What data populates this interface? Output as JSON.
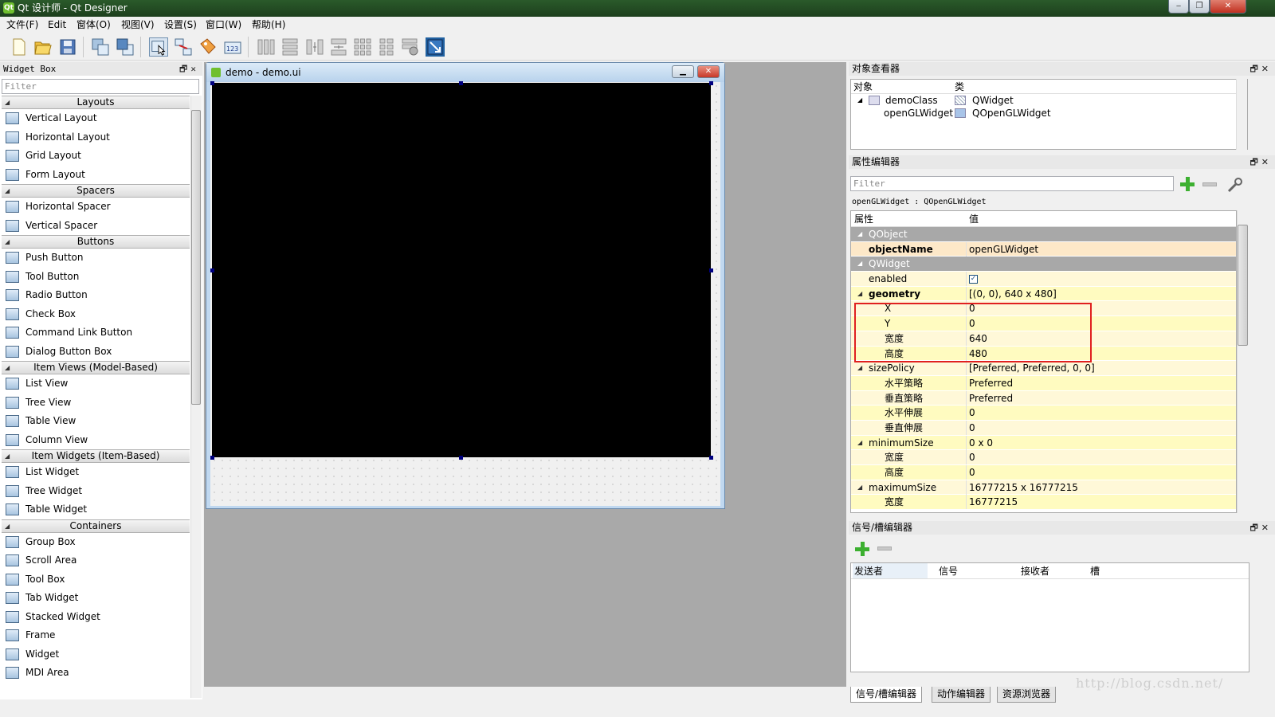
{
  "window": {
    "title": "Qt 设计师 - Qt Designer",
    "min": "‒",
    "max": "❐",
    "close": "✕"
  },
  "menu": [
    "文件(F)",
    "Edit",
    "窗体(O)",
    "视图(V)",
    "设置(S)",
    "窗口(W)",
    "帮助(H)"
  ],
  "widget_box": {
    "title": "Widget Box",
    "filter_placeholder": "Filter",
    "categories": [
      {
        "label": "Layouts",
        "items": [
          "Vertical Layout",
          "Horizontal Layout",
          "Grid Layout",
          "Form Layout"
        ]
      },
      {
        "label": "Spacers",
        "items": [
          "Horizontal Spacer",
          "Vertical Spacer"
        ]
      },
      {
        "label": "Buttons",
        "items": [
          "Push Button",
          "Tool Button",
          "Radio Button",
          "Check Box",
          "Command Link Button",
          "Dialog Button Box"
        ]
      },
      {
        "label": "Item Views (Model-Based)",
        "items": [
          "List View",
          "Tree View",
          "Table View",
          "Column View"
        ]
      },
      {
        "label": "Item Widgets (Item-Based)",
        "items": [
          "List Widget",
          "Tree Widget",
          "Table Widget"
        ]
      },
      {
        "label": "Containers",
        "items": [
          "Group Box",
          "Scroll Area",
          "Tool Box",
          "Tab Widget",
          "Stacked Widget",
          "Frame",
          "Widget",
          "MDI Area"
        ]
      }
    ]
  },
  "form": {
    "title": "demo - demo.ui"
  },
  "object_inspector": {
    "title": "对象查看器",
    "col_object": "对象",
    "col_class": "类",
    "rows": [
      {
        "object": "demoClass",
        "class": "QWidget"
      },
      {
        "object": "openGLWidget",
        "class": "QOpenGLWidget"
      }
    ]
  },
  "property_editor": {
    "title": "属性编辑器",
    "filter_placeholder": "Filter",
    "object_label": "openGLWidget : QOpenGLWidget",
    "col_property": "属性",
    "col_value": "值",
    "rows": [
      {
        "name": "QObject",
        "value": ""
      },
      {
        "name": "objectName",
        "value": "openGLWidget"
      },
      {
        "name": "QWidget",
        "value": ""
      },
      {
        "name": "enabled",
        "value": ""
      },
      {
        "name": "geometry",
        "value": "[(0, 0), 640 x 480]"
      },
      {
        "name": "X",
        "value": "0"
      },
      {
        "name": "Y",
        "value": "0"
      },
      {
        "name": "宽度",
        "value": "640"
      },
      {
        "name": "高度",
        "value": "480"
      },
      {
        "name": "sizePolicy",
        "value": "[Preferred, Preferred, 0, 0]"
      },
      {
        "name": "水平策略",
        "value": "Preferred"
      },
      {
        "name": "垂直策略",
        "value": "Preferred"
      },
      {
        "name": "水平伸展",
        "value": "0"
      },
      {
        "name": "垂直伸展",
        "value": "0"
      },
      {
        "name": "minimumSize",
        "value": "0 x 0"
      },
      {
        "name": "宽度",
        "value": "0"
      },
      {
        "name": "高度",
        "value": "0"
      },
      {
        "name": "maximumSize",
        "value": "16777215 x 16777215"
      },
      {
        "name": "宽度",
        "value": "16777215"
      }
    ]
  },
  "signal_slot": {
    "title": "信号/槽编辑器",
    "columns": [
      "发送者",
      "信号",
      "接收者",
      "槽"
    ]
  },
  "bottom_tabs": [
    "信号/槽编辑器",
    "动作编辑器",
    "资源浏览器"
  ],
  "watermark": "http://blog.csdn.net/",
  "colors": {
    "highlight": "#e02020",
    "group_row": "#a8a8a8",
    "yellow_row": "#fffbc0",
    "gl_widget": "#000000"
  }
}
